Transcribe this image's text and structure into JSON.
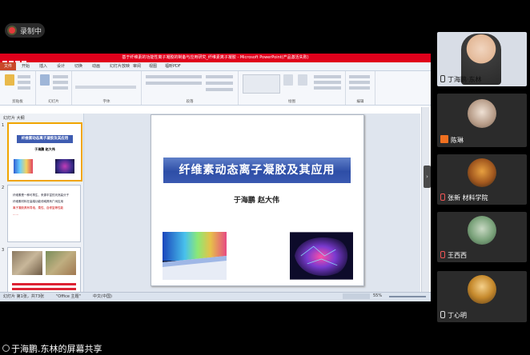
{
  "recording": {
    "label": "录制中"
  },
  "ppt": {
    "window_title": "基于纤维素的功能性离子凝胶的制备与应用研究_纤维素离子凝胶 - Microsoft PowerPoint(产品激活失败)",
    "file_tab": "文件",
    "tabs": [
      "开始",
      "插入",
      "设计",
      "切换",
      "动画",
      "幻灯片放映",
      "审阅",
      "视图",
      "福昕PDF"
    ],
    "groups": [
      "剪贴板",
      "幻灯片",
      "字体",
      "段落",
      "绘图",
      "编辑"
    ],
    "panel_tabs": "幻灯片 大纲",
    "thumb1_title": "纤维素动态离子凝胶及其应用",
    "thumb1_authors": "于海鹏 赵大伟",
    "thumb2_lines": [
      "纤维素是一种可再生、来源丰富的天然高分子",
      "纤维素材料在高端功能领域具有广阔应用",
      "离子凝胶具有导电、柔性、自修复等性能",
      "……"
    ],
    "slide_numbers": [
      "1",
      "2",
      "3"
    ],
    "slide": {
      "title": "纤维素动态离子凝胶及其应用",
      "authors": "于海鹏  赵大伟"
    },
    "status": {
      "slide_info": "幻灯片 第1张，共73张",
      "theme": "\"Office 主题\"",
      "lang": "中文(中国)",
      "zoom": "55%"
    }
  },
  "participants": [
    {
      "name": "丁海鹏·东林",
      "muted": false
    },
    {
      "name": "陈琳",
      "muted": false
    },
    {
      "name": "张新 材料学院",
      "muted": true
    },
    {
      "name": "王西西",
      "muted": true
    },
    {
      "name": "丁心明",
      "muted": false
    }
  ],
  "share_banner": "于海鹏.东林的屏幕共享"
}
